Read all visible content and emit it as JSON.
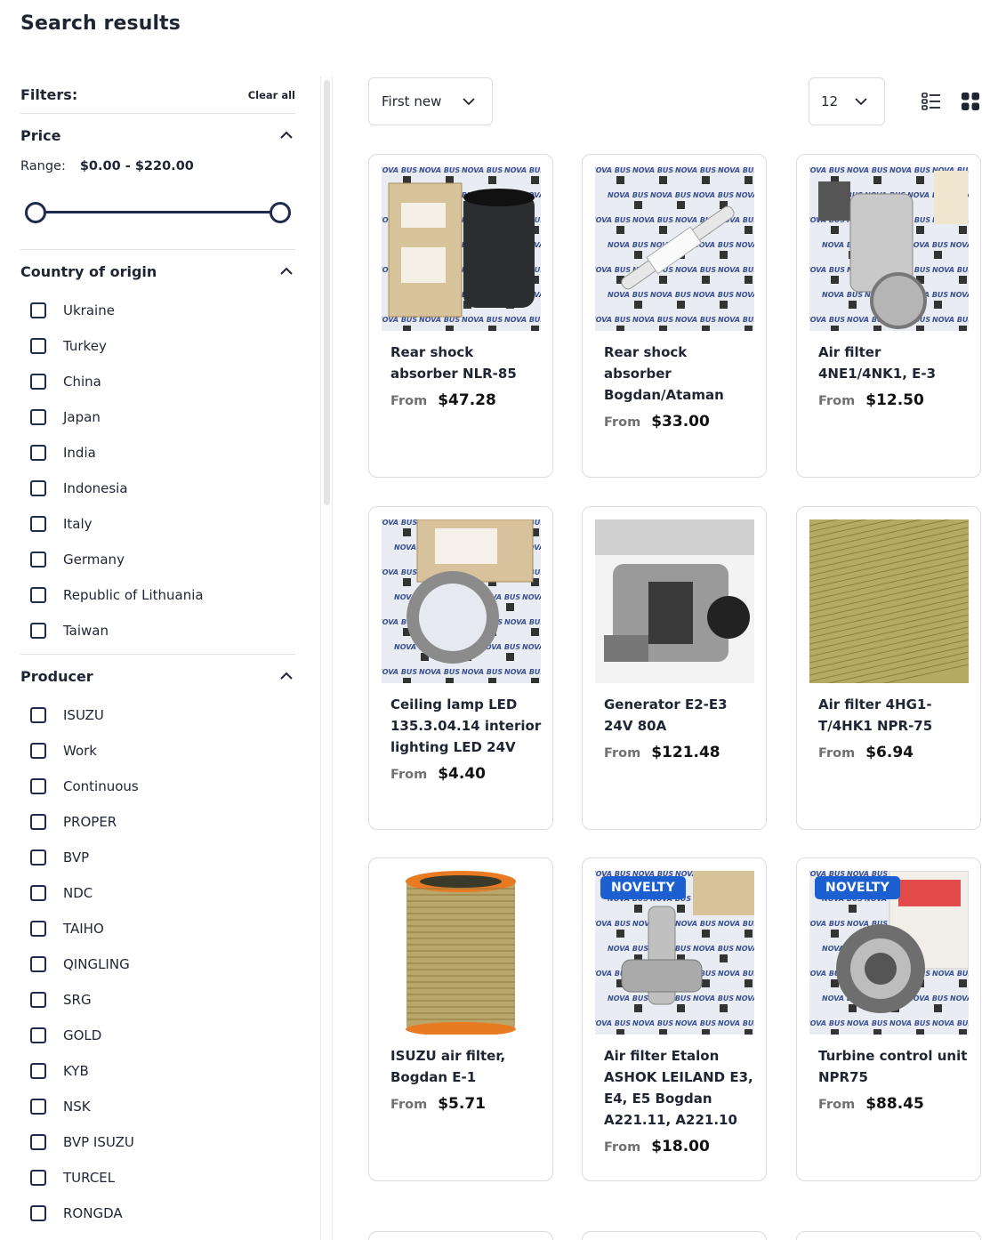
{
  "page": {
    "title": "Search results"
  },
  "filters": {
    "title": "Filters:",
    "clear_all": "Clear all",
    "price": {
      "title": "Price",
      "range_label": "Range:",
      "range_value": "$0.00 - $220.00"
    },
    "country": {
      "title": "Country of origin",
      "options": [
        "Ukraine",
        "Turkey",
        "China",
        "Japan",
        "India",
        "Indonesia",
        "Italy",
        "Germany",
        "Republic of Lithuania",
        "Taiwan"
      ]
    },
    "producer": {
      "title": "Producer",
      "options": [
        "ISUZU",
        "Work",
        "Continuous",
        "PROPER",
        "BVP",
        "NDC",
        "TAIHO",
        "QINGLING",
        "SRG",
        "GOLD",
        "KYB",
        "NSK",
        "BVP ISUZU",
        "TURCEL",
        "RONGDA"
      ]
    }
  },
  "toolbar": {
    "sort_value": "First new",
    "per_page_value": "12"
  },
  "products": [
    {
      "title": "Rear shock absorber NLR-85",
      "from": "From",
      "price": "$47.28",
      "badge": ""
    },
    {
      "title": "Rear shock absorber Bogdan/Ataman",
      "from": "From",
      "price": "$33.00",
      "badge": ""
    },
    {
      "title": "Air filter 4NE1/4NK1, E-3",
      "from": "From",
      "price": "$12.50",
      "badge": ""
    },
    {
      "title": "Ceiling lamp LED 135.3.04.14 interior lighting LED 24V",
      "from": "From",
      "price": "$4.40",
      "badge": ""
    },
    {
      "title": "Generator E2-E3 24V 80A",
      "from": "From",
      "price": "$121.48",
      "badge": ""
    },
    {
      "title": "Air filter 4HG1-T/4HK1 NPR-75",
      "from": "From",
      "price": "$6.94",
      "badge": ""
    },
    {
      "title": "ISUZU air filter, Bogdan E-1",
      "from": "From",
      "price": "$5.71",
      "badge": ""
    },
    {
      "title": "Air filter Etalon ASHOK LEILAND E3, E4, E5 Bogdan A221.11, A221.10",
      "from": "From",
      "price": "$18.00",
      "badge": "NOVELTY"
    },
    {
      "title": "Turbine control unit NPR75",
      "from": "From",
      "price": "$88.45",
      "badge": "NOVELTY"
    }
  ],
  "colors": {
    "accent": "#1f2b4d",
    "badge": "#1b5fd0",
    "border": "#dcdcdc"
  },
  "icons": [
    "chevron-up-icon",
    "chevron-down-icon",
    "list-view-icon",
    "grid-view-icon"
  ]
}
